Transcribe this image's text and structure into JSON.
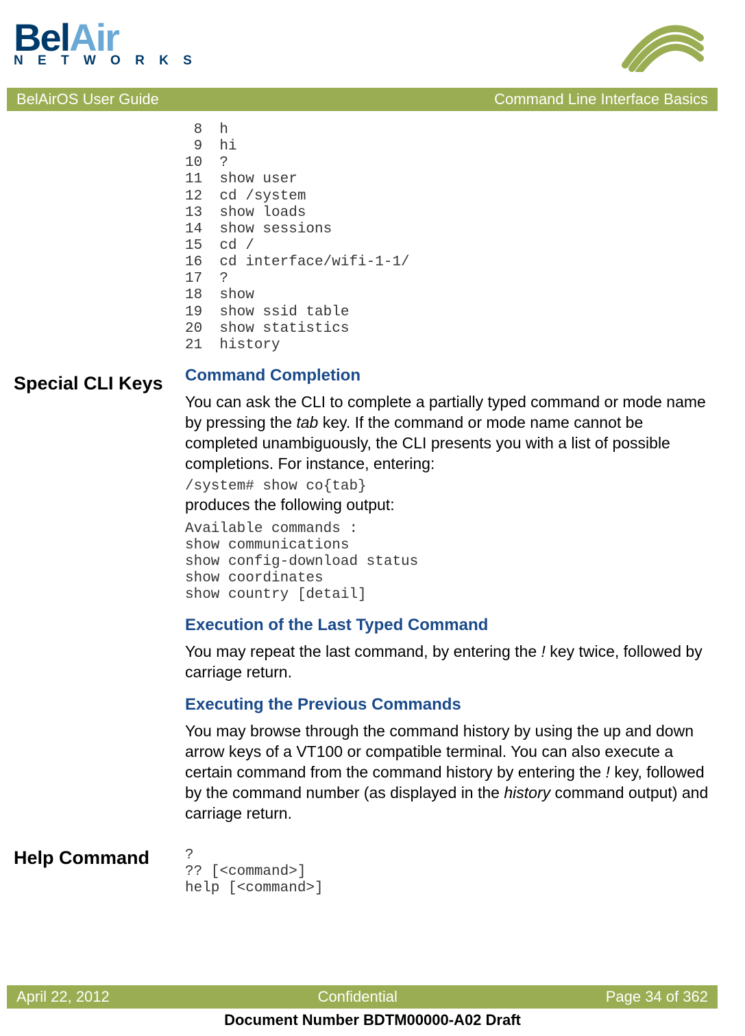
{
  "logo": {
    "line1a": "Bel",
    "line1b": "Air",
    "line2": "N E T W O R K S"
  },
  "titlebar": {
    "left": "BelAirOS User Guide",
    "right": "Command Line Interface Basics"
  },
  "history_block": " 8  h\n 9  hi\n10  ?\n11  show user\n12  cd /system\n13  show loads\n14  show sessions\n15  cd /\n16  cd interface/wifi-1-1/\n17  ?\n18  show\n19  show ssid table\n20  show statistics\n21  history",
  "sections": {
    "special_keys_heading": "Special CLI Keys",
    "help_heading": "Help Command",
    "cmd_completion": {
      "title": "Command Completion",
      "p1a": "You can ask the CLI to complete a partially typed command or mode name by pressing the ",
      "p1_tab": "tab",
      "p1b": " key. If the command or mode name cannot be completed unambiguously, the CLI presents you with a list of possible completions. For instance, entering:",
      "example1": "/system# show co{tab}",
      "p2": "produces the following output:",
      "example2": "Available commands :\nshow communications\nshow config-download status\nshow coordinates\nshow country [detail]"
    },
    "exec_last": {
      "title": "Execution of the Last Typed Command",
      "p1a": "You may repeat the last command, by entering the ",
      "p1_bang": "!",
      "p1b": " key twice, followed by carriage return."
    },
    "exec_prev": {
      "title": "Executing the Previous Commands",
      "p1a": "You may browse through the command history by using the up and down arrow keys of a VT100 or compatible terminal. You can also execute a certain command from the command history by entering the ",
      "p1_bang": "!",
      "p1b": " key, followed by the command number (as displayed in the ",
      "p1_hist": "history",
      "p1c": " command output) and carriage return."
    },
    "help_block": "?\n?? [<command>]\nhelp [<command>]"
  },
  "footer": {
    "left": "April 22, 2012",
    "center": "Confidential",
    "right": "Page 34 of 362"
  },
  "subfooter": "Document Number BDTM00000-A02 Draft"
}
